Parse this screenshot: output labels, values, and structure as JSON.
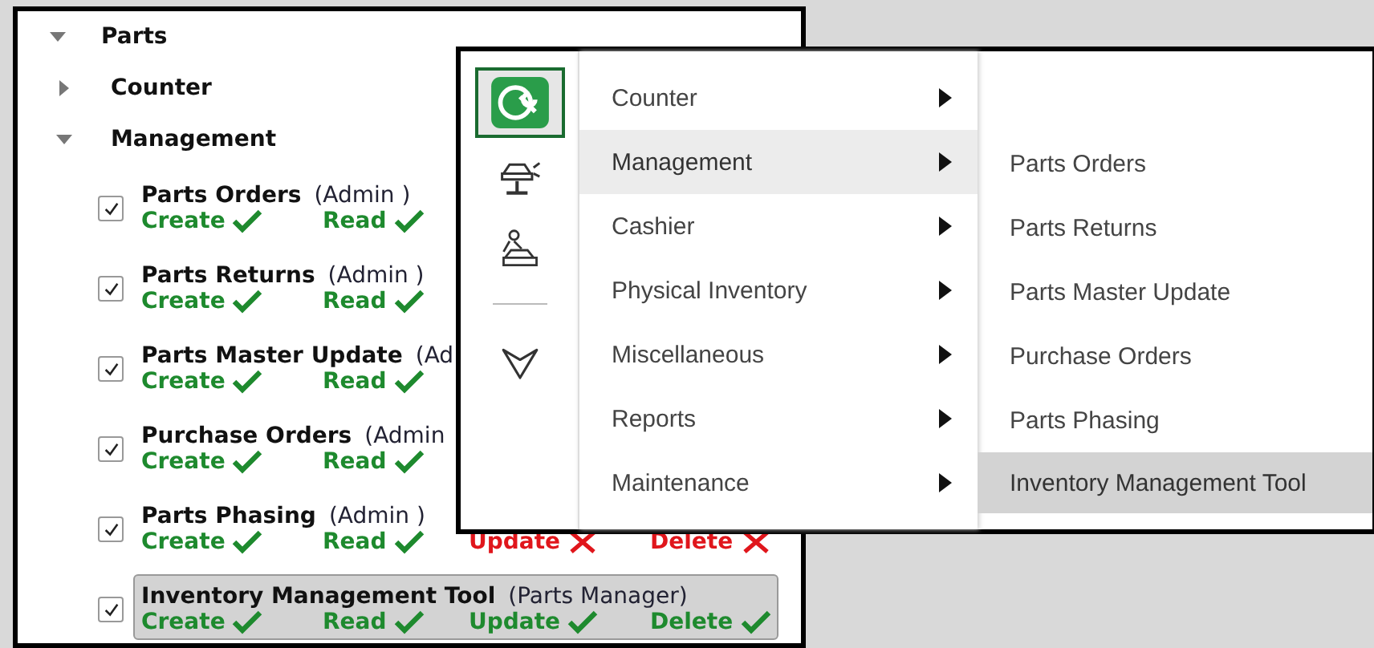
{
  "tree": {
    "label": "Parts",
    "expanded": true,
    "children": [
      {
        "label": "Counter",
        "expanded": false
      },
      {
        "label": "Management",
        "expanded": true,
        "items": [
          {
            "name": "Parts Orders",
            "role": "(Admin )",
            "checked": true,
            "selected": false,
            "permissions": [
              {
                "label": "Create",
                "granted": true
              },
              {
                "label": "Read",
                "granted": true
              }
            ]
          },
          {
            "name": "Parts Returns",
            "role": "(Admin )",
            "checked": true,
            "selected": false,
            "permissions": [
              {
                "label": "Create",
                "granted": true
              },
              {
                "label": "Read",
                "granted": true
              }
            ]
          },
          {
            "name": "Parts Master Update",
            "role": "(Ad",
            "checked": true,
            "selected": false,
            "permissions": [
              {
                "label": "Create",
                "granted": true
              },
              {
                "label": "Read",
                "granted": true
              }
            ]
          },
          {
            "name": "Purchase Orders",
            "role": "(Admin",
            "checked": true,
            "selected": false,
            "permissions": [
              {
                "label": "Create",
                "granted": true
              },
              {
                "label": "Read",
                "granted": true
              }
            ]
          },
          {
            "name": "Parts Phasing",
            "role": "(Admin )",
            "checked": true,
            "selected": false,
            "permissions": [
              {
                "label": "Create",
                "granted": true
              },
              {
                "label": "Read",
                "granted": true
              },
              {
                "label": "Update",
                "granted": false
              },
              {
                "label": "Delete",
                "granted": false
              }
            ]
          },
          {
            "name": "Inventory Management Tool",
            "role": "(Parts Manager)",
            "checked": true,
            "selected": true,
            "permissions": [
              {
                "label": "Create",
                "granted": true
              },
              {
                "label": "Read",
                "granted": true
              },
              {
                "label": "Update",
                "granted": true
              },
              {
                "label": "Delete",
                "granted": true
              }
            ]
          }
        ]
      }
    ]
  },
  "popup": {
    "rail": [
      {
        "kind": "parts",
        "selected": true
      },
      {
        "kind": "lift",
        "selected": false
      },
      {
        "kind": "service",
        "selected": false
      },
      {
        "kind": "chevron",
        "selected": false
      }
    ],
    "menu": [
      {
        "label": "Counter",
        "selected": false
      },
      {
        "label": "Management",
        "selected": true
      },
      {
        "label": "Cashier",
        "selected": false
      },
      {
        "label": "Physical Inventory",
        "selected": false
      },
      {
        "label": "Miscellaneous",
        "selected": false
      },
      {
        "label": "Reports",
        "selected": false
      },
      {
        "label": "Maintenance",
        "selected": false
      }
    ],
    "submenu": [
      {
        "label": "Parts Orders",
        "selected": false
      },
      {
        "label": "Parts Returns",
        "selected": false
      },
      {
        "label": "Parts Master Update",
        "selected": false
      },
      {
        "label": "Purchase Orders",
        "selected": false
      },
      {
        "label": "Parts Phasing",
        "selected": false
      },
      {
        "label": "Inventory Management Tool",
        "selected": true
      }
    ]
  }
}
